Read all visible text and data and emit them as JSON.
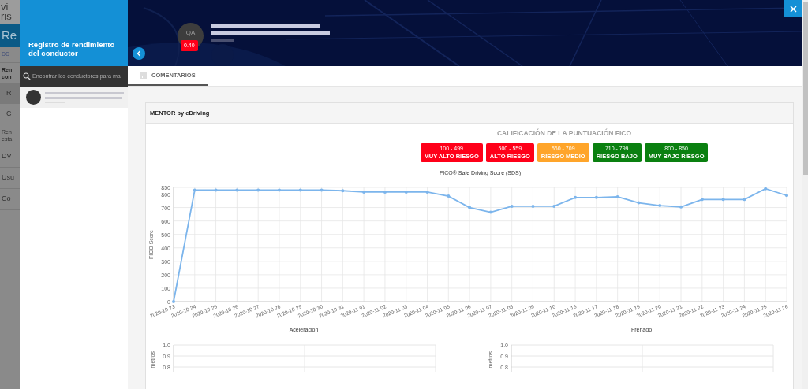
{
  "background_menu": [
    "vi",
    "ris",
    "Re",
    "DD",
    "Ren",
    "con",
    "R",
    "C",
    "Ren",
    "esta",
    "DV",
    "Usu",
    "Co"
  ],
  "drawer": {
    "title": "Registro de rendimiento del conductor",
    "search": {
      "placeholder": "Encontrar los conductores para ma"
    },
    "drivers": [
      {
        "selected": true
      }
    ]
  },
  "profile": {
    "initials": "QA",
    "score": "0.40"
  },
  "tabs": [
    {
      "label": "COMENTARIOS",
      "selected": true
    }
  ],
  "card": {
    "title": "MENTOR by eDriving",
    "legend_title": "CALIFICACIÓN DE LA PUNTUACIÓN FICO",
    "legend": [
      {
        "range": "100 - 499",
        "label": "MUY ALTO RIESGO",
        "color": "#ff0019"
      },
      {
        "range": "500 - 559",
        "label": "ALTO RIESGO",
        "color": "#ff0019"
      },
      {
        "range": "560 - 709",
        "label": "RIESGO MEDIO",
        "color": "#ffa52a"
      },
      {
        "range": "710 - 799",
        "label": "RIESGO BAJO",
        "color": "#0a8010"
      },
      {
        "range": "800 - 850",
        "label": "MUY BAJO RIESGO",
        "color": "#0a8010"
      }
    ],
    "chart_data": {
      "type": "line",
      "grid": true,
      "title": "FICO® Safe Driving Score (SDS)",
      "ylabel": "FICO Score",
      "ylim": [
        0,
        850
      ],
      "yticks": [
        0,
        100,
        200,
        300,
        400,
        500,
        600,
        700,
        800,
        850
      ],
      "categories": [
        "2020-10-23",
        "2020-10-24",
        "2020-10-25",
        "2020-10-26",
        "2020-10-27",
        "2020-10-28",
        "2020-10-29",
        "2020-10-30",
        "2020-10-31",
        "2020-11-01",
        "2020-11-02",
        "2020-11-03",
        "2020-11-04",
        "2020-11-05",
        "2020-11-06",
        "2020-11-07",
        "2020-11-08",
        "2020-11-09",
        "2020-11-10",
        "2020-11-16",
        "2020-11-17",
        "2020-11-18",
        "2020-11-19",
        "2020-11-20",
        "2020-11-21",
        "2020-11-22",
        "2020-11-23",
        "2020-11-24",
        "2020-11-25",
        "2020-11-26"
      ],
      "series": [
        {
          "color": "#7cb5ec",
          "values": [
            0,
            830,
            830,
            830,
            830,
            830,
            830,
            830,
            825,
            815,
            815,
            815,
            815,
            785,
            700,
            665,
            710,
            710,
            710,
            775,
            775,
            780,
            735,
            715,
            705,
            760,
            760,
            760,
            840,
            790
          ]
        }
      ]
    },
    "small_charts": [
      {
        "title": "Aceleración",
        "ylabel": "metros",
        "tick_labels": [
          "1.0",
          "0.9",
          "0.8"
        ]
      },
      {
        "title": "Frenado",
        "ylabel": "metros",
        "tick_labels": [
          "1.0",
          "0.9",
          "0.8"
        ]
      }
    ]
  }
}
